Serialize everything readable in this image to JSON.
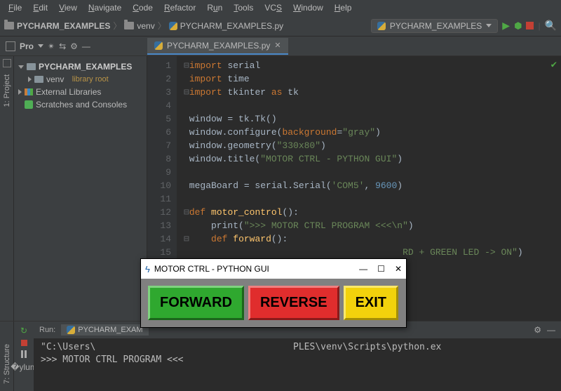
{
  "menu": [
    "File",
    "Edit",
    "View",
    "Navigate",
    "Code",
    "Refactor",
    "Run",
    "Tools",
    "VCS",
    "Window",
    "Help"
  ],
  "breadcrumb": {
    "project": "PYCHARM_EXAMPLES",
    "folder": "venv",
    "file": "PYCHARM_EXAMPLES.py"
  },
  "run_config": "PYCHARM_EXAMPLES",
  "project_toolbar_label": "Pro",
  "file_tab": "PYCHARM_EXAMPLES.py",
  "tree": {
    "root": "PYCHARM_EXAMPLES",
    "venv": "venv",
    "venv_hint": "library root",
    "external": "External Libraries",
    "scratches": "Scratches and Consoles"
  },
  "sidetabs": {
    "project": "1: Project",
    "structure": "7: Structure"
  },
  "code_lines": [
    "import serial",
    "import time",
    "import tkinter as tk",
    "",
    "window = tk.Tk()",
    "window.configure(background=\"gray\")",
    "window.geometry(\"330x80\")",
    "window.title(\"MOTOR CTRL - PYTHON GUI\")",
    "",
    "megaBoard = serial.Serial('COM5', 9600)",
    "",
    "def motor_control():",
    "    print(\">>> MOTOR CTRL PROGRAM <<<\\n\")",
    "    def forward():",
    "                                      RD + GREEN LED -> ON\")"
  ],
  "line_numbers": [
    "1",
    "2",
    "3",
    "4",
    "5",
    "6",
    "7",
    "8",
    "9",
    "10",
    "11",
    "12",
    "13",
    "14",
    "15"
  ],
  "run_tab_label": "Run:",
  "run_tab_name": "PYCHARM_EXAM",
  "console": {
    "line1": "\"C:\\Users\\                                    PLES\\venv\\Scripts\\python.ex",
    "line2": ">>> MOTOR CTRL PROGRAM <<<"
  },
  "gui": {
    "title": "MOTOR CTRL - PYTHON GUI",
    "forward": "FORWARD",
    "reverse": "REVERSE",
    "exit": "EXIT"
  }
}
